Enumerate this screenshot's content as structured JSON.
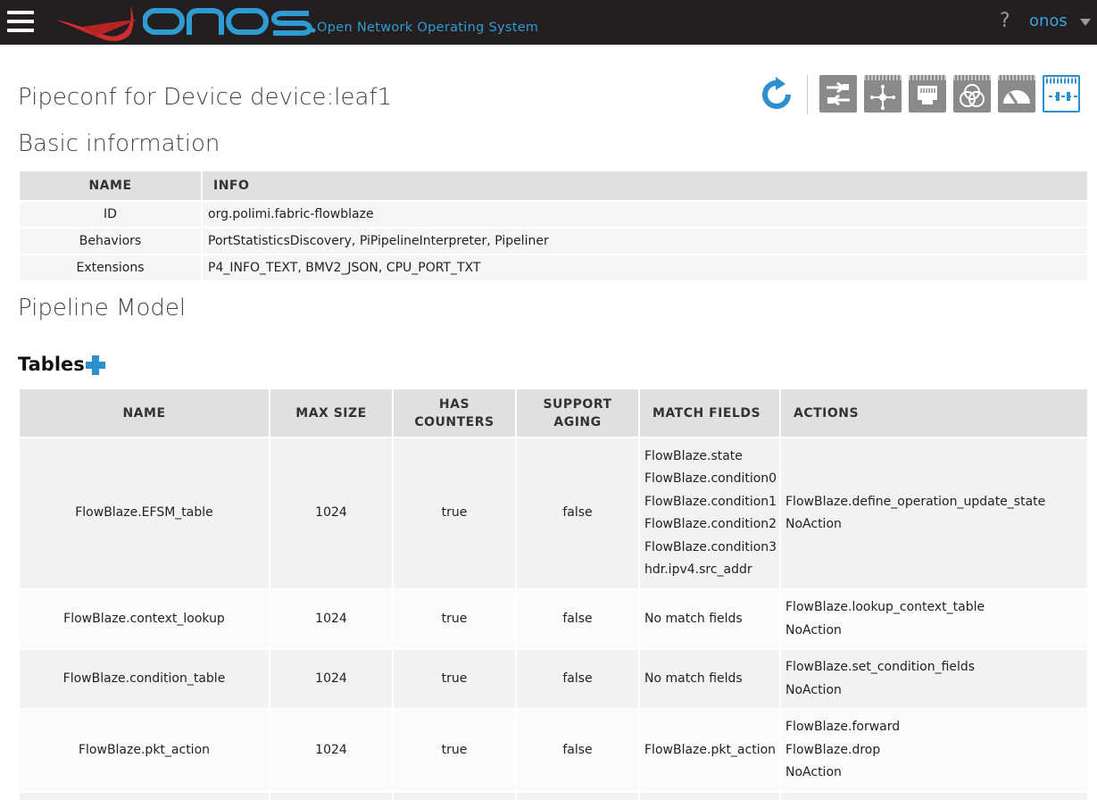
{
  "header": {
    "brand": "ONOS",
    "subtitle": "Open Network Operating System",
    "help": "?",
    "user": "onos"
  },
  "page": {
    "title": "Pipeconf for Device device:leaf1"
  },
  "toolbar": {
    "icons": [
      "refresh-icon",
      "devices-icon",
      "flows-icon",
      "ports-icon",
      "groups-icon",
      "meters-icon",
      "pipeconf-icon"
    ]
  },
  "basic_info": {
    "heading": "Basic information",
    "columns": [
      "NAME",
      "INFO"
    ],
    "rows": [
      {
        "name": "ID",
        "info": "org.polimi.fabric-flowblaze"
      },
      {
        "name": "Behaviors",
        "info": "PortStatisticsDiscovery, PiPipelineInterpreter, Pipeliner"
      },
      {
        "name": "Extensions",
        "info": "P4_INFO_TEXT, BMV2_JSON, CPU_PORT_TXT"
      }
    ]
  },
  "pipeline_model": {
    "heading": "Pipeline Model",
    "tables_heading": "Tables",
    "columns": {
      "name": "NAME",
      "max_size": "MAX SIZE",
      "has_counters_1": "HAS",
      "has_counters_2": "COUNTERS",
      "support_aging_1": "SUPPORT",
      "support_aging_2": "AGING",
      "match_fields": "MATCH FIELDS",
      "actions": "ACTIONS"
    },
    "rows": [
      {
        "name": "FlowBlaze.EFSM_table",
        "max_size": "1024",
        "has_counters": "true",
        "support_aging": "false",
        "match_fields": [
          "FlowBlaze.state",
          "FlowBlaze.condition0",
          "FlowBlaze.condition1",
          "FlowBlaze.condition2",
          "FlowBlaze.condition3",
          "hdr.ipv4.src_addr"
        ],
        "actions": [
          "FlowBlaze.define_operation_update_state",
          "NoAction"
        ]
      },
      {
        "name": "FlowBlaze.context_lookup",
        "max_size": "1024",
        "has_counters": "true",
        "support_aging": "false",
        "match_fields": [
          "No match fields"
        ],
        "actions": [
          "FlowBlaze.lookup_context_table",
          "NoAction"
        ]
      },
      {
        "name": "FlowBlaze.condition_table",
        "max_size": "1024",
        "has_counters": "true",
        "support_aging": "false",
        "match_fields": [
          "No match fields"
        ],
        "actions": [
          "FlowBlaze.set_condition_fields",
          "NoAction"
        ]
      },
      {
        "name": "FlowBlaze.pkt_action",
        "max_size": "1024",
        "has_counters": "true",
        "support_aging": "false",
        "match_fields": [
          "FlowBlaze.pkt_action"
        ],
        "actions": [
          "FlowBlaze.forward",
          "FlowBlaze.drop",
          "NoAction"
        ]
      }
    ]
  }
}
